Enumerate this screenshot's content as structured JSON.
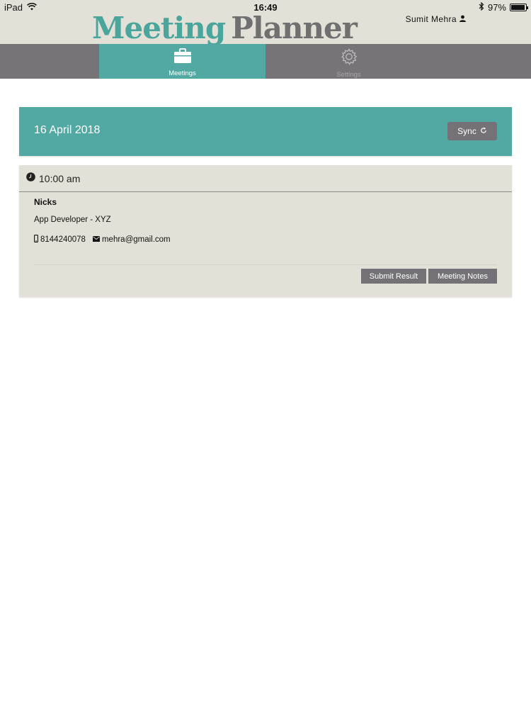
{
  "status_bar": {
    "device": "iPad",
    "time": "16:49",
    "battery": "97%",
    "battery_level": 0.97
  },
  "header": {
    "logo_part1": "Meeting",
    "logo_part2": "Planner",
    "user_name": "Sumit Mehra"
  },
  "tabs": [
    {
      "label": "Meetings",
      "icon": "briefcase-icon",
      "active": true
    },
    {
      "label": "Settings",
      "icon": "gear-icon",
      "active": false
    }
  ],
  "date_card": {
    "date": "16 April 2018",
    "sync_label": "Sync"
  },
  "meeting": {
    "time": "10:00 am",
    "name": "Nicks",
    "role": "App Developer - XYZ",
    "phone": "8144240078",
    "email": "mehra@gmail.com",
    "submit_label": "Submit Result",
    "notes_label": "Meeting Notes"
  },
  "colors": {
    "accent": "#52a9a3",
    "tabbar": "#767477",
    "header_bg": "#e3e1d7",
    "button": "#747277"
  }
}
